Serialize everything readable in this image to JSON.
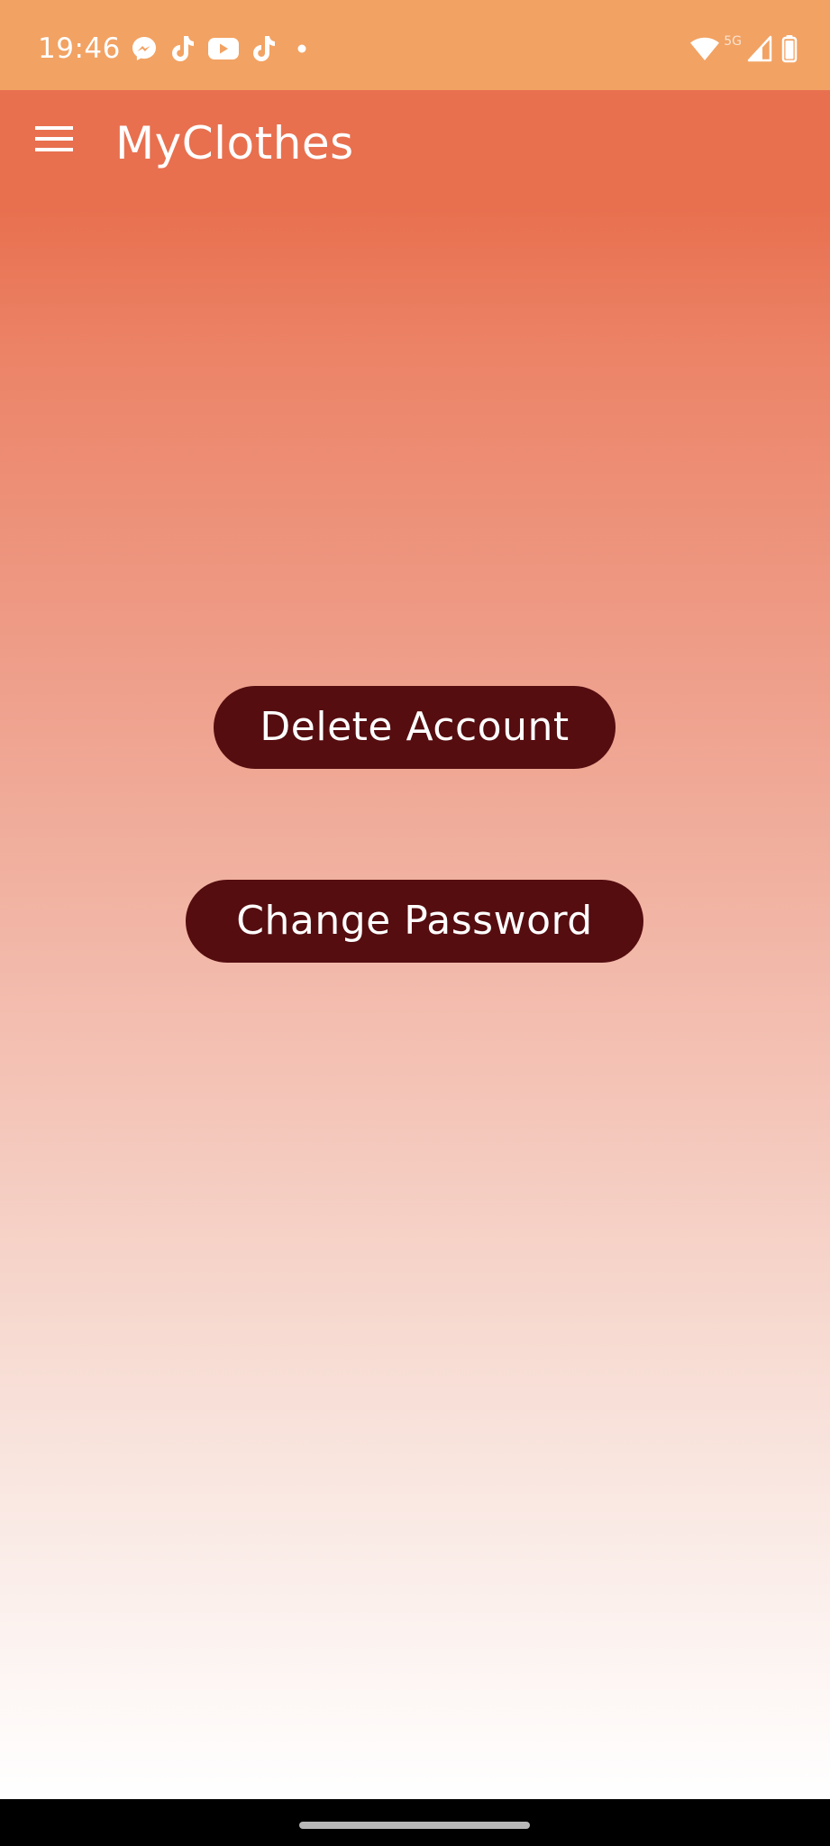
{
  "status_bar": {
    "time": "19:46",
    "network_label": "5G",
    "left_icons": [
      "messenger-icon",
      "tiktok-icon",
      "youtube-icon",
      "tiktok-icon",
      "more-notifications-dot-icon"
    ],
    "right_icons": [
      "wifi-icon",
      "cell-signal-icon",
      "battery-icon"
    ],
    "background_color": "#f2a263"
  },
  "app_bar": {
    "title": "MyClothes",
    "menu_icon": "hamburger-menu-icon"
  },
  "main": {
    "delete_account_label": "Delete Account",
    "change_password_label": "Change Password",
    "button_color": "#550d10",
    "gradient_top_color": "#e8704f",
    "gradient_bottom_color": "#ffffff"
  },
  "nav_bar": {
    "handle": "home-gesture-handle"
  }
}
